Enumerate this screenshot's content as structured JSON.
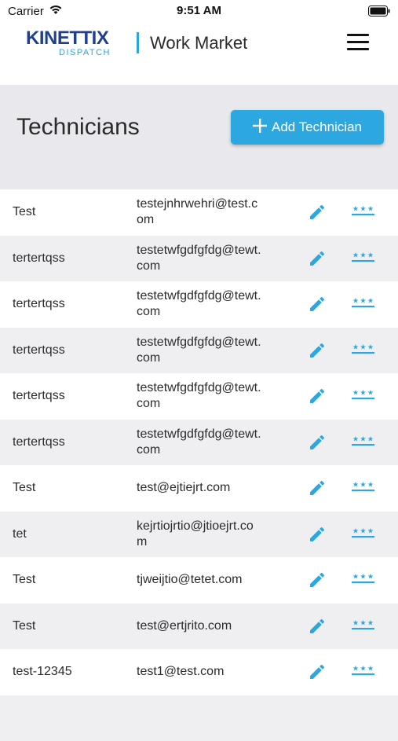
{
  "status_bar": {
    "carrier": "Carrier",
    "time": "9:51 AM"
  },
  "header": {
    "logo_main": "KINETTIX",
    "logo_sub": "DISPATCH",
    "title": "Work Market",
    "menu_icon": "hamburger-menu-icon"
  },
  "page": {
    "title": "Technicians",
    "add_button_label": "Add Technician",
    "add_button_icon": "plus-icon"
  },
  "colors": {
    "accent": "#2ca7df",
    "logo_blue": "#1f3f8f",
    "band_gray": "#e9e9ed",
    "row_alt": "#efeff1"
  },
  "row_icons": {
    "edit": "pencil-icon",
    "password": "password-asterisks-icon"
  },
  "technicians": [
    {
      "name": "Test",
      "email": "testejnhrwehri@test.com"
    },
    {
      "name": "tertertqss",
      "email": "testetwfgdfgfdg@tewt.com"
    },
    {
      "name": "tertertqss",
      "email": "testetwfgdfgfdg@tewt.com"
    },
    {
      "name": "tertertqss",
      "email": "testetwfgdfgfdg@tewt.com"
    },
    {
      "name": "tertertqss",
      "email": "testetwfgdfgfdg@tewt.com"
    },
    {
      "name": "tertertqss",
      "email": "testetwfgdfgfdg@tewt.com"
    },
    {
      "name": "Test",
      "email": "test@ejtiejrt.com"
    },
    {
      "name": "tet",
      "email": "kejrtiojrtio@jtioejrt.com"
    },
    {
      "name": "Test",
      "email": "tjweijtio@tetet.com"
    },
    {
      "name": "Test",
      "email": "test@ertjrito.com"
    },
    {
      "name": "test-12345",
      "email": "test1@test.com"
    },
    {
      "name": "",
      "email": ""
    }
  ]
}
